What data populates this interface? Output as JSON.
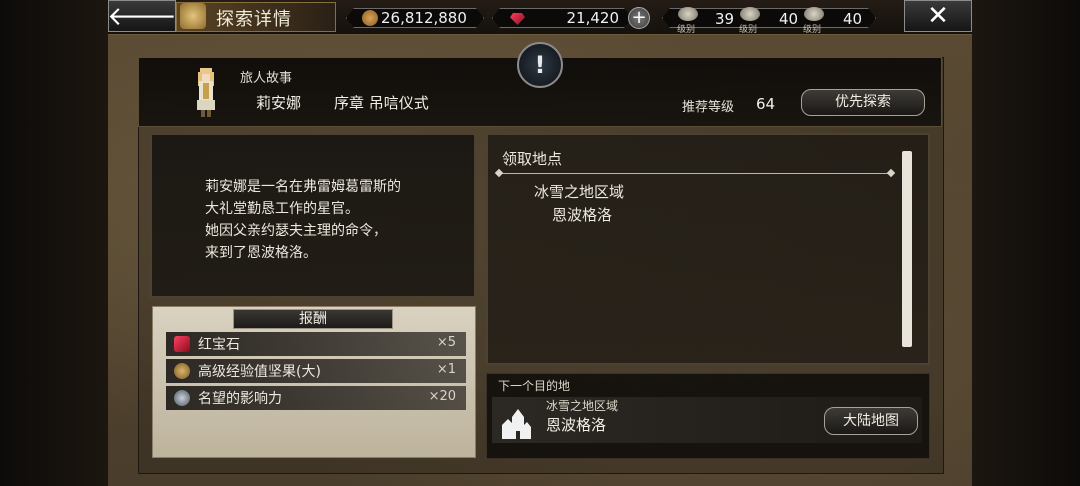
{
  "header": {
    "back_label": "🡐",
    "title": "探索详情",
    "close_label": "✕",
    "money": "26,812,880",
    "gems": "21,420",
    "plus_label": "+",
    "levels": [
      {
        "icon": "skull-crest-icon",
        "sub": "级别",
        "value": "39"
      },
      {
        "icon": "brain-crest-icon",
        "sub": "级别",
        "value": "40"
      },
      {
        "icon": "star-crest-icon",
        "sub": "级别",
        "value": "40"
      }
    ]
  },
  "info": {
    "category": "旅人故事",
    "name": "莉安娜",
    "chapter": "序章  吊唁仪式",
    "recommended_label": "推荐等级",
    "recommended_value": "64",
    "priority_button": "优先探索",
    "emblem": "!"
  },
  "story": {
    "text": "莉安娜是一名在弗雷姆葛雷斯的\n大礼堂勤恳工作的星官。\n她因父亲约瑟夫主理的命令，\n来到了恩波格洛。"
  },
  "rewards": {
    "title": "报酬",
    "items": [
      {
        "icon": "ruby-icon",
        "label": "红宝石",
        "count": "×5"
      },
      {
        "icon": "exp-nut-icon",
        "label": "高级经验值坚果(大)",
        "count": "×1"
      },
      {
        "icon": "reputation-icon",
        "label": "名望的影响力",
        "count": "×20"
      }
    ]
  },
  "location": {
    "title": "领取地点",
    "region": "冰雪之地区域",
    "place": "恩波格洛"
  },
  "destination": {
    "label": "下一个目的地",
    "region": "冰雪之地区域",
    "place": "恩波格洛",
    "map_button": "大陆地图"
  },
  "colors": {
    "panel_dark": "#1a1712",
    "reward_bg": "#cfc6b1",
    "gem_red": "#e0213b",
    "text_light": "#eee9df"
  }
}
